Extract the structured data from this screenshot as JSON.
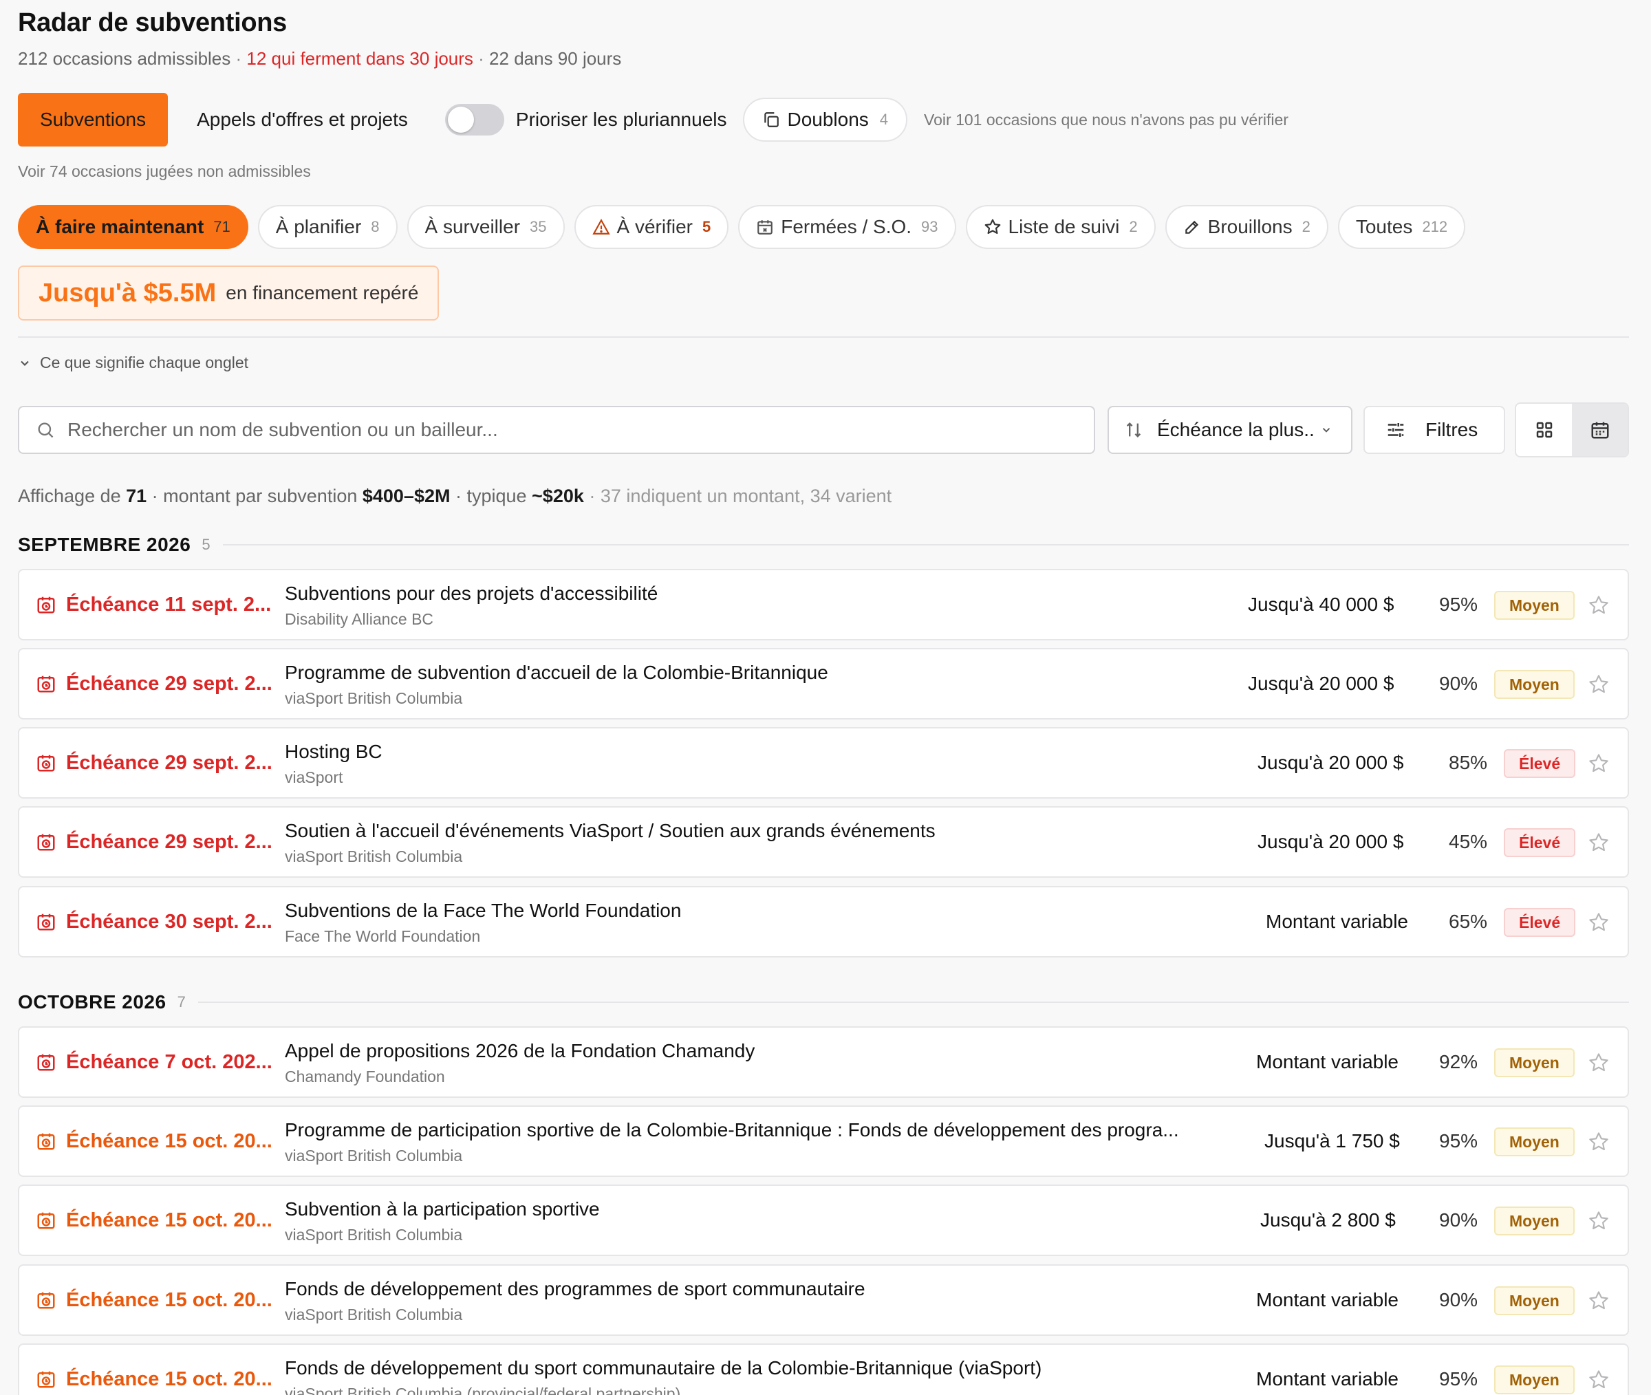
{
  "header": {
    "title": "Radar de subventions",
    "eligible": "212 occasions admissibles",
    "sep1": " · ",
    "closing_soon": "12 qui ferment dans 30 jours",
    "sep2": " · ",
    "within_90": "22 dans 90 jours"
  },
  "type_row": {
    "grants_label": "Subventions",
    "tenders_label": "Appels d'offres et projets",
    "multiyear_toggle_label": "Prioriser les pluriannuels",
    "multiyear_toggle_on": false,
    "duplicates_label": "Doublons",
    "duplicates_count": "4",
    "unverified_link": "Voir 101 occasions que nous n'avons pas pu vérifier"
  },
  "noneligible_link": "Voir 74 occasions jugées non admissibles",
  "tabs": [
    {
      "label": "À faire maintenant",
      "count": "71"
    },
    {
      "label": "À planifier",
      "count": "8"
    },
    {
      "label": "À surveiller",
      "count": "35"
    },
    {
      "label": "À vérifier",
      "count": "5",
      "icon": "warning-icon"
    },
    {
      "label": "Fermées / S.O.",
      "count": "93",
      "icon": "calendar-x-icon"
    },
    {
      "label": "Liste de suivi",
      "count": "2",
      "icon": "star-icon"
    },
    {
      "label": "Brouillons",
      "count": "2",
      "icon": "pencil-icon"
    },
    {
      "label": "Toutes",
      "count": "212"
    }
  ],
  "funding": {
    "amount": "Jusqu'à $5.5M",
    "caption": "en financement repéré"
  },
  "explain_toggle": "Ce que signifie chaque onglet",
  "search": {
    "placeholder": "Rechercher un nom de subvention ou un bailleur..."
  },
  "sort": {
    "label": "Échéance la plus.."
  },
  "filters": {
    "label": "Filtres"
  },
  "summary": {
    "prefix": "Affichage de ",
    "shown": "71",
    "range_label": " · montant par subvention ",
    "range": "$400–$2M",
    "typical_label": " · typique ",
    "typical": "~$20k",
    "note": " · 37 indiquent un montant, 34 varient"
  },
  "groups": [
    {
      "month": "SEPTEMBRE 2026",
      "count": "5",
      "rows": [
        {
          "deadline": "Échéance 11 sept. 2...",
          "name": "Subventions pour des projets d'accessibilité",
          "org": "Disability Alliance BC",
          "amount": "Jusqu'à 40 000 $",
          "match": "95%",
          "priority": "Moyen"
        },
        {
          "deadline": "Échéance 29 sept. 2...",
          "name": "Programme de subvention d'accueil de la Colombie-Britannique",
          "org": "viaSport British Columbia",
          "amount": "Jusqu'à 20 000 $",
          "match": "90%",
          "priority": "Moyen"
        },
        {
          "deadline": "Échéance 29 sept. 2...",
          "name": "Hosting BC",
          "org": "viaSport",
          "amount": "Jusqu'à 20 000 $",
          "match": "85%",
          "priority": "Élevé"
        },
        {
          "deadline": "Échéance 29 sept. 2...",
          "name": "Soutien à l'accueil d'événements ViaSport / Soutien aux grands événements",
          "org": "viaSport British Columbia",
          "amount": "Jusqu'à 20 000 $",
          "match": "45%",
          "priority": "Élevé"
        },
        {
          "deadline": "Échéance 30 sept. 2...",
          "name": "Subventions de la Face The World Foundation",
          "org": "Face The World Foundation",
          "amount": "Montant variable",
          "match": "65%",
          "priority": "Élevé"
        }
      ]
    },
    {
      "month": "OCTOBRE 2026",
      "count": "7",
      "rows": [
        {
          "deadline": "Échéance 7 oct. 202...",
          "name": "Appel de propositions 2026 de la Fondation Chamandy",
          "org": "Chamandy Foundation",
          "amount": "Montant variable",
          "match": "92%",
          "priority": "Moyen"
        },
        {
          "deadline": "Échéance 15 oct. 20...",
          "name": "Programme de participation sportive de la Colombie-Britannique : Fonds de développement des progra...",
          "org": "viaSport British Columbia",
          "amount": "Jusqu'à 1 750 $",
          "match": "95%",
          "priority": "Moyen"
        },
        {
          "deadline": "Échéance 15 oct. 20...",
          "name": "Subvention à la participation sportive",
          "org": "viaSport British Columbia",
          "amount": "Jusqu'à 2 800 $",
          "match": "90%",
          "priority": "Moyen"
        },
        {
          "deadline": "Échéance 15 oct. 20...",
          "name": "Fonds de développement des programmes de sport communautaire",
          "org": "viaSport British Columbia",
          "amount": "Montant variable",
          "match": "90%",
          "priority": "Moyen"
        },
        {
          "deadline": "Échéance 15 oct. 20...",
          "name": "Fonds de développement du sport communautaire de la Colombie-Britannique (viaSport)",
          "org": "viaSport British Columbia (provincial/federal partnership)",
          "amount": "Montant variable",
          "match": "95%",
          "priority": "Moyen"
        }
      ]
    }
  ],
  "colors": {
    "accent": "#f97316",
    "urgent": "#dc2626",
    "deadline_orange": "#ea580c",
    "medium_bg": "#fef9e7",
    "medium_text": "#a16207",
    "high_bg": "#fdecec",
    "high_text": "#dc2626"
  }
}
